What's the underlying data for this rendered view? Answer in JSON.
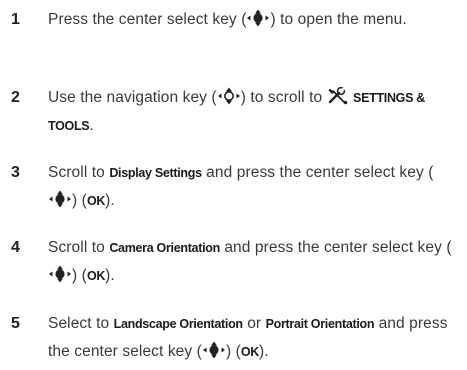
{
  "steps": [
    {
      "number": "1",
      "parts": [
        {
          "t": "text",
          "v": "Press the center select key ("
        },
        {
          "t": "icon",
          "icon": "center-select-key-icon"
        },
        {
          "t": "text",
          "v": ") to open the menu."
        }
      ]
    },
    {
      "number": "2",
      "parts": [
        {
          "t": "text",
          "v": "Use the navigation key ("
        },
        {
          "t": "icon",
          "icon": "navigation-key-icon"
        },
        {
          "t": "text",
          "v": ") to scroll to "
        },
        {
          "t": "icon",
          "icon": "settings-tools-icon"
        },
        {
          "t": "text",
          "v": " "
        },
        {
          "t": "term",
          "v": "SETTINGS & TOOLS"
        },
        {
          "t": "text",
          "v": "."
        }
      ]
    },
    {
      "number": "3",
      "parts": [
        {
          "t": "text",
          "v": "Scroll to "
        },
        {
          "t": "term",
          "v": "Display Settings"
        },
        {
          "t": "text",
          "v": " and press the center select key ("
        },
        {
          "t": "icon",
          "icon": "center-select-key-icon"
        },
        {
          "t": "text",
          "v": ") ("
        },
        {
          "t": "term",
          "v": "OK"
        },
        {
          "t": "text",
          "v": ")."
        }
      ]
    },
    {
      "number": "4",
      "parts": [
        {
          "t": "text",
          "v": "Scroll to "
        },
        {
          "t": "term",
          "v": "Camera Orientation"
        },
        {
          "t": "text",
          "v": " and press the center select key ("
        },
        {
          "t": "icon",
          "icon": "center-select-key-icon"
        },
        {
          "t": "text",
          "v": ") ("
        },
        {
          "t": "term",
          "v": "OK"
        },
        {
          "t": "text",
          "v": ")."
        }
      ]
    },
    {
      "number": "5",
      "parts": [
        {
          "t": "text",
          "v": "Select to "
        },
        {
          "t": "term",
          "v": "Landscape Orientation"
        },
        {
          "t": "text",
          "v": " or "
        },
        {
          "t": "term",
          "v": "Portrait Orientation"
        },
        {
          "t": "text",
          "v": " and press the center select key ("
        },
        {
          "t": "icon",
          "icon": "center-select-key-icon"
        },
        {
          "t": "text",
          "v": ") ("
        },
        {
          "t": "term",
          "v": "OK"
        },
        {
          "t": "text",
          "v": ")."
        }
      ]
    }
  ]
}
